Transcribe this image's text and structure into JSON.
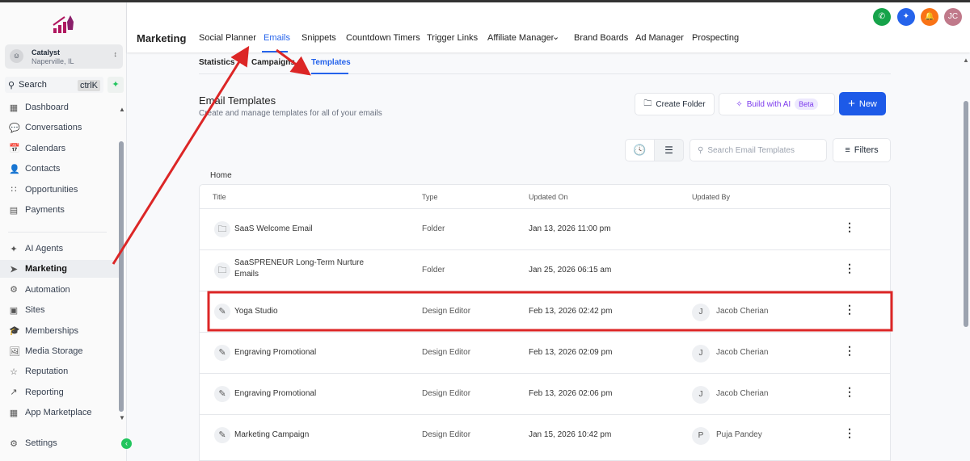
{
  "sidebar": {
    "location_name": "Catalyst",
    "location_city": "Naperville, IL",
    "search_label": "Search",
    "search_shortcut": "ctrlK",
    "items_top": [
      {
        "label": "Dashboard",
        "icon": "grid-icon"
      },
      {
        "label": "Conversations",
        "icon": "chat-icon"
      },
      {
        "label": "Calendars",
        "icon": "calendar-icon"
      },
      {
        "label": "Contacts",
        "icon": "contacts-icon"
      },
      {
        "label": "Opportunities",
        "icon": "opportunities-icon"
      },
      {
        "label": "Payments",
        "icon": "payments-icon"
      }
    ],
    "items_bottom": [
      {
        "label": "AI Agents"
      },
      {
        "label": "Marketing"
      },
      {
        "label": "Automation"
      },
      {
        "label": "Sites"
      },
      {
        "label": "Memberships"
      },
      {
        "label": "Media Storage"
      },
      {
        "label": "Reputation"
      },
      {
        "label": "Reporting"
      },
      {
        "label": "App Marketplace"
      }
    ],
    "settings": "Settings"
  },
  "header": {
    "title": "Marketing",
    "tabs": [
      "Social Planner",
      "Emails",
      "Snippets",
      "Countdown Timers",
      "Trigger Links",
      "Affiliate Manager",
      "Brand Boards",
      "Ad Manager",
      "Prospecting"
    ],
    "avatar": "JC",
    "colors": {
      "phone": "#16a34a",
      "ai": "#2563eb",
      "bell": "#f97316",
      "avatar": "#c0798a"
    }
  },
  "subtabs": [
    "Statistics",
    "Campaigns",
    "Templates"
  ],
  "page": {
    "title": "Email Templates",
    "subtitle": "Create and manage templates for all of your emails",
    "create_folder": "Create Folder",
    "build_ai": "Build with AI",
    "beta": "Beta",
    "new": "New",
    "search_placeholder": "Search Email Templates",
    "filters": "Filters",
    "breadcrumb": "Home"
  },
  "table": {
    "headers": [
      "Title",
      "Type",
      "Updated On",
      "Updated By"
    ],
    "rows": [
      {
        "title": "SaaS Welcome Email",
        "type": "Folder",
        "updated": "Jan 13, 2026 11:00 pm",
        "initial": "",
        "by": ""
      },
      {
        "title": "SaaSPRENEUR Long-Term Nurture Emails",
        "type": "Folder",
        "updated": "Jan 25, 2026 06:15 am",
        "initial": "",
        "by": ""
      },
      {
        "title": "Yoga Studio",
        "type": "Design Editor",
        "updated": "Feb 13, 2026 02:42 pm",
        "initial": "J",
        "by": "Jacob Cherian"
      },
      {
        "title": "Engraving Promotional",
        "type": "Design Editor",
        "updated": "Feb 13, 2026 02:09 pm",
        "initial": "J",
        "by": "Jacob Cherian"
      },
      {
        "title": "Engraving Promotional",
        "type": "Design Editor",
        "updated": "Feb 13, 2026 02:06 pm",
        "initial": "J",
        "by": "Jacob Cherian"
      },
      {
        "title": "Marketing Campaign",
        "type": "Design Editor",
        "updated": "Jan 15, 2026 10:42 pm",
        "initial": "P",
        "by": "Puja Pandey"
      }
    ]
  },
  "annotation_color": "#dc2626"
}
